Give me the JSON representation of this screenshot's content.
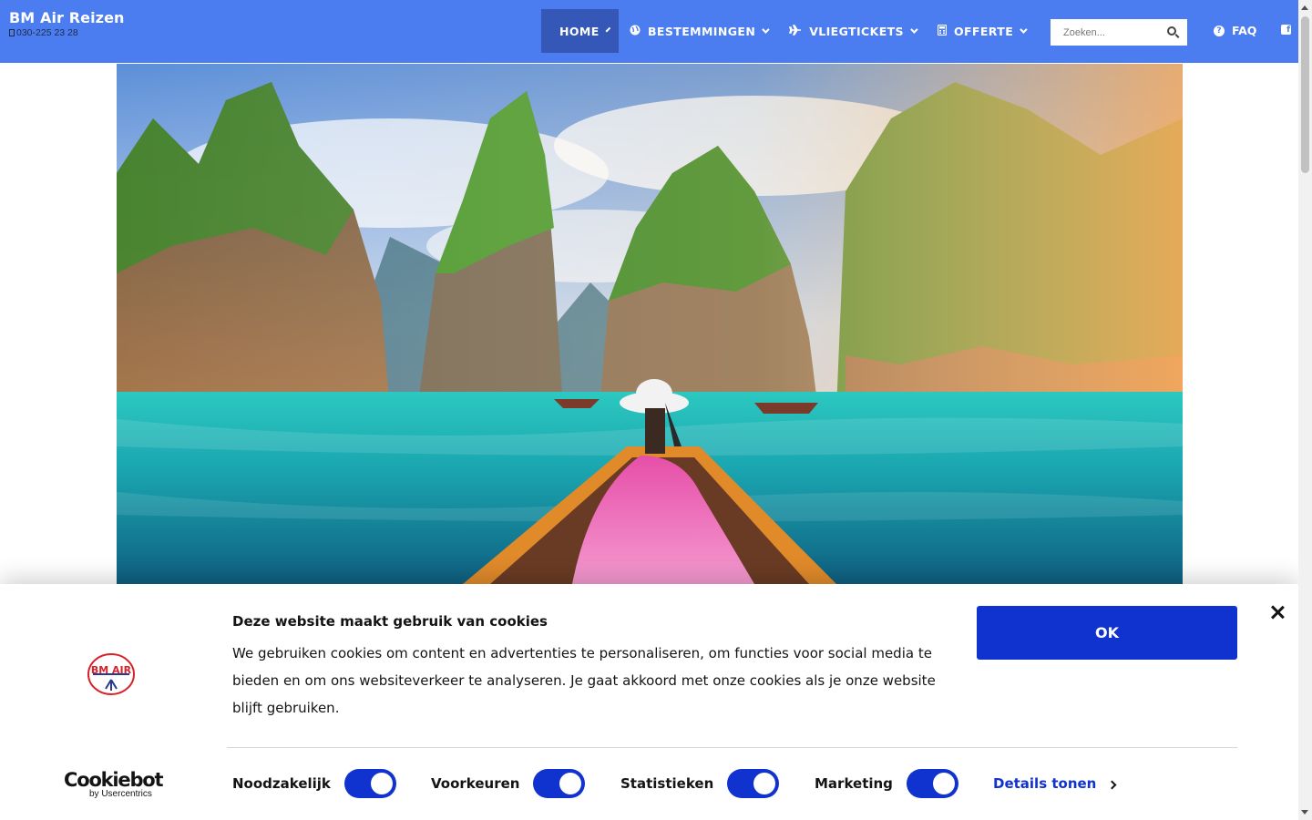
{
  "header": {
    "brand_title": "BM Air Reizen",
    "phone": "030-225 23 28",
    "nav": [
      {
        "label": "HOME",
        "icon": "none"
      },
      {
        "label": "BESTEMMINGEN",
        "icon": "globe-icon"
      },
      {
        "label": "VLIEGTICKETS",
        "icon": "plane-icon"
      },
      {
        "label": "OFFERTE",
        "icon": "calculator-icon"
      }
    ],
    "search_placeholder": "Zoeken...",
    "faq_label": "FAQ",
    "colors": {
      "bar": "#4c7df0",
      "active": "#3558b8"
    }
  },
  "cookie": {
    "title": "Deze website maakt gebruik van cookies",
    "text": "We gebruiken cookies om content en advertenties te personaliseren, om functies voor social media te bieden en om ons websiteverkeer te analyseren. Je gaat akkoord met onze cookies als je onze website blijft gebruiken.",
    "ok_label": "OK",
    "toggles": [
      {
        "label": "Noodzakelijk",
        "on": true
      },
      {
        "label": "Voorkeuren",
        "on": true
      },
      {
        "label": "Statistieken",
        "on": true
      },
      {
        "label": "Marketing",
        "on": true
      }
    ],
    "details_label": "Details tonen",
    "provider_name": "Cookiebot",
    "provider_sub": "by Usercentrics",
    "logo_text": "BM AIR",
    "colors": {
      "primary": "#1032cf",
      "logo_red": "#d8222a"
    }
  }
}
